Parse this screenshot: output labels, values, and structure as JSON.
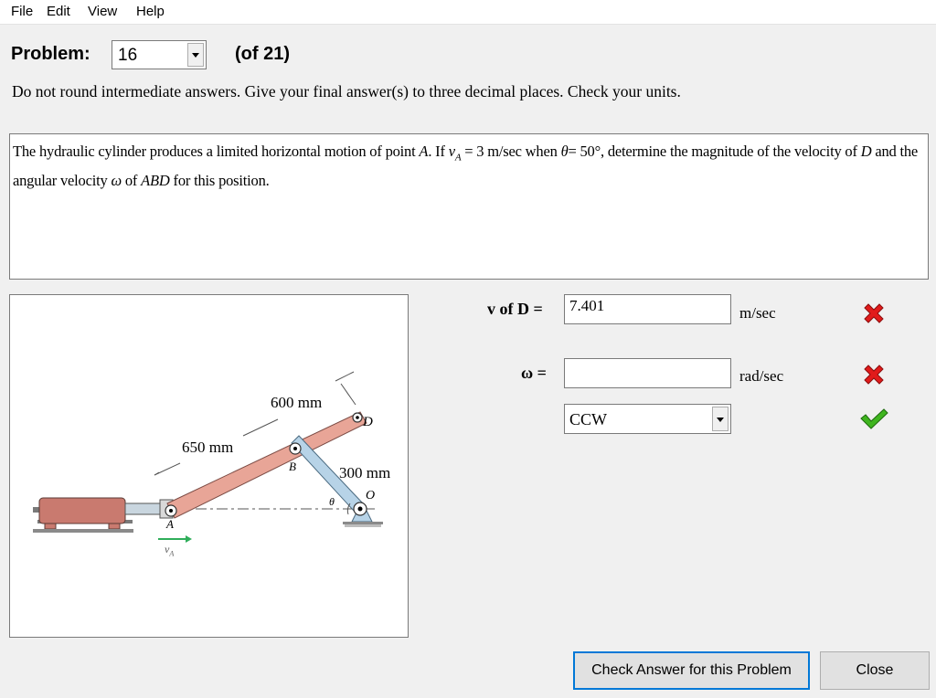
{
  "menu": {
    "items": [
      "File",
      "Edit",
      "View",
      "Help"
    ]
  },
  "problem": {
    "label": "Problem:",
    "number": "16",
    "of_text": "(of 21)"
  },
  "instructions": "Do not round intermediate answers.  Give your final answer(s) to three decimal places.  Check your units.",
  "problem_text": {
    "t1": "The hydraulic cylinder produces a limited horizontal motion of point ",
    "A": "A",
    "t2": ". If ",
    "v": "v",
    "vsub": "A",
    "t3": " = 3 m/sec when ",
    "theta": "θ",
    "t4": "= 50°, determine the magnitude of the velocity of ",
    "D": "D",
    "t5": " and the angular velocity ",
    "omega": "ω",
    "t6": " of ",
    "ABD": "ABD",
    "t7": " for this position."
  },
  "figure": {
    "label_600": "600 mm",
    "label_650": "650 mm",
    "label_300": "300 mm",
    "label_D": "D",
    "label_B": "B",
    "label_O": "O",
    "label_A": "A",
    "label_theta": "θ",
    "label_vA": "v",
    "label_vA_sub": "A"
  },
  "answers": {
    "vD_label": "v of D =",
    "vD_value": "7.401",
    "vD_unit": "m/sec",
    "omega_label": "ω =",
    "omega_value": "",
    "omega_unit": "rad/sec",
    "direction_value": "CCW"
  },
  "status_icons": [
    "x-icon",
    "x-icon",
    "check-icon"
  ],
  "colors": {
    "incorrect": "#e11b1b",
    "correct": "#3fb51f",
    "link_fill": "#e8a597",
    "rod_fill": "#b7d3e7",
    "velocity_arrow": "#2fae5a"
  },
  "buttons": {
    "check": "Check Answer for this Problem",
    "close": "Close"
  }
}
